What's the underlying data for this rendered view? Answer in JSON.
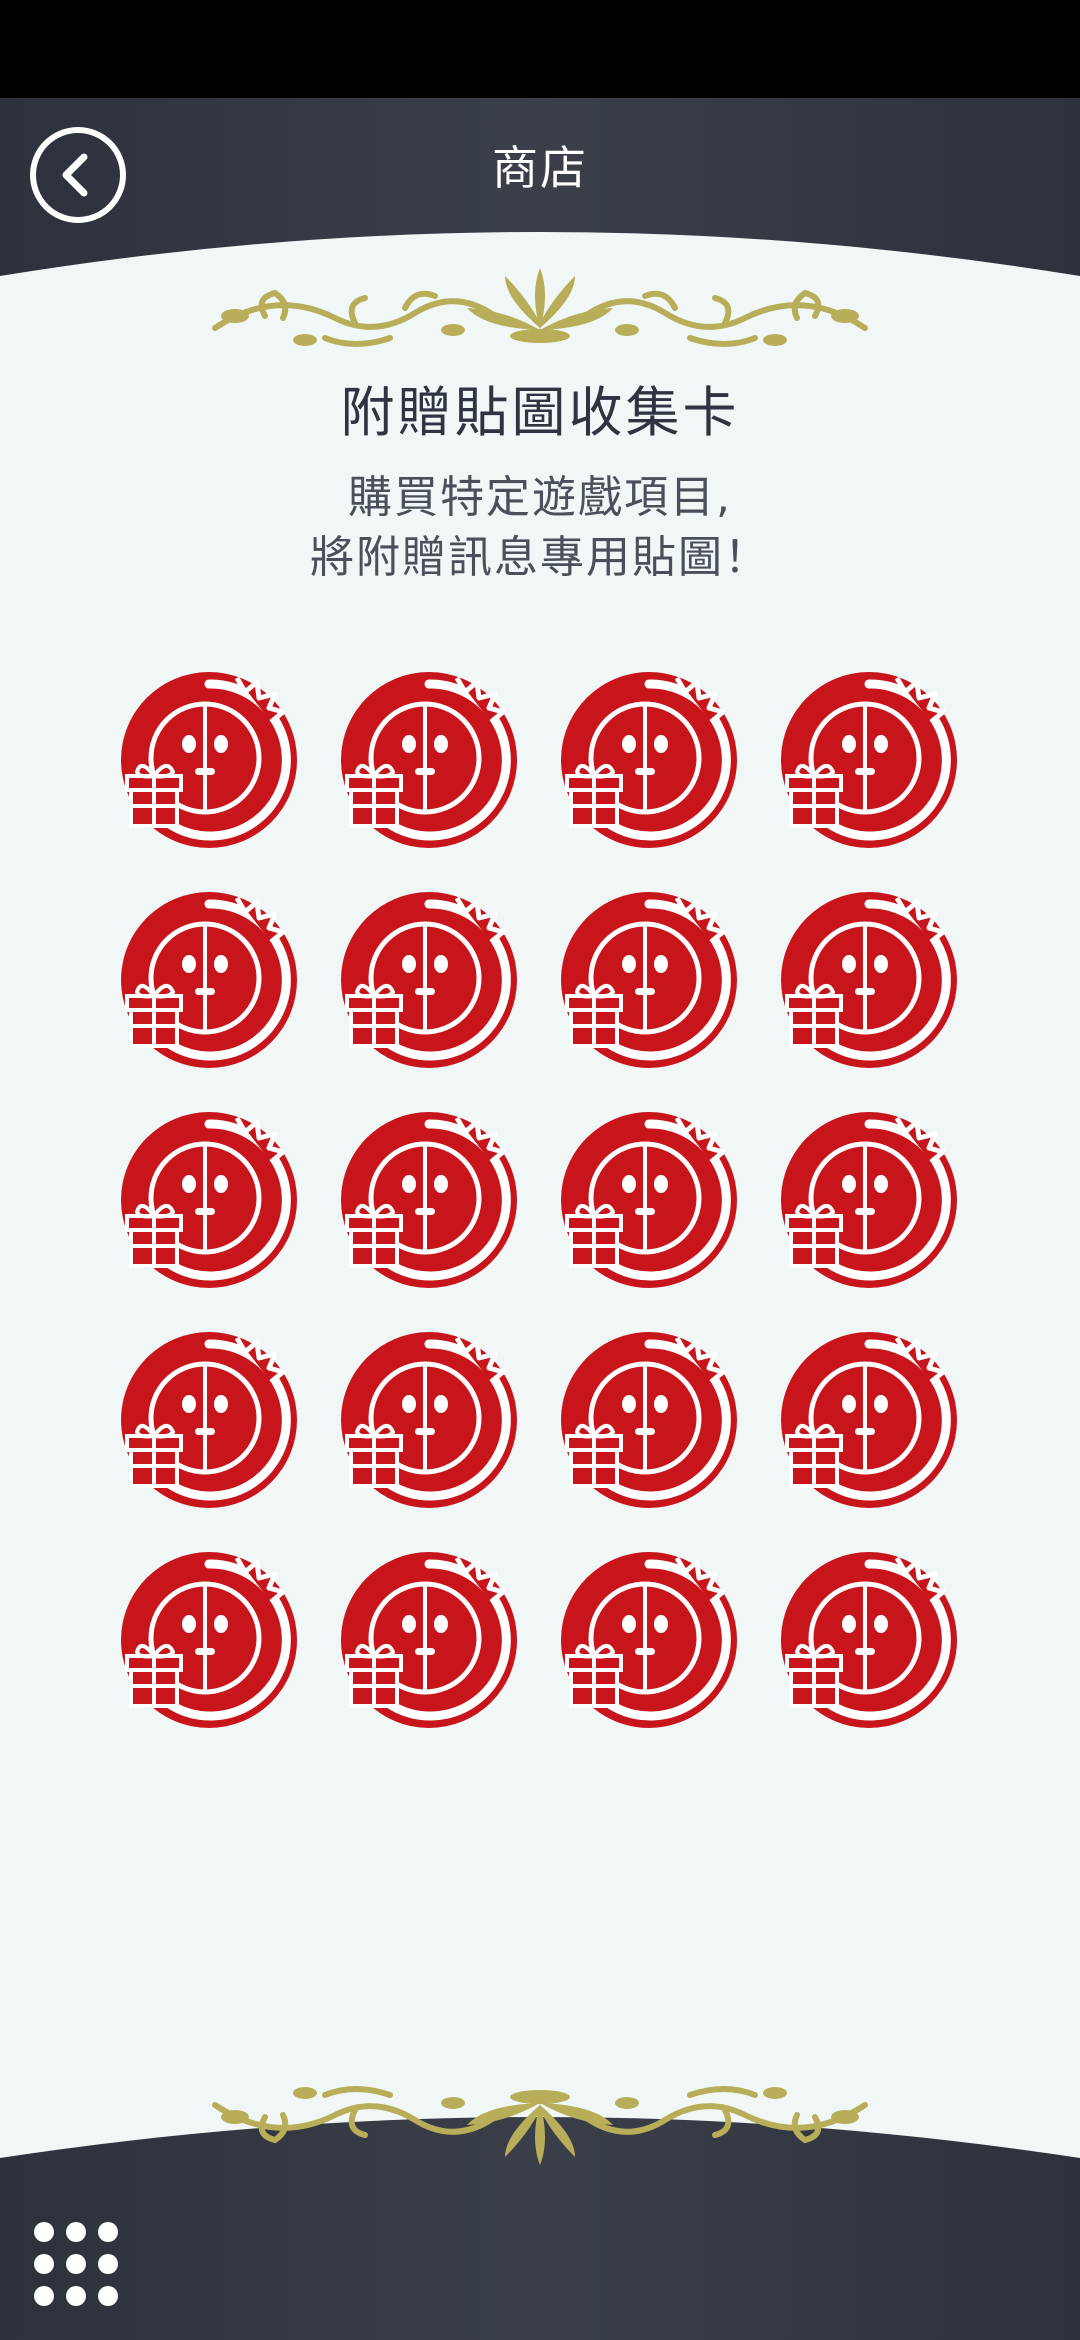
{
  "header": {
    "title": "商店",
    "back_icon": "chevron-left-circle-icon"
  },
  "card": {
    "title": "附贈貼圖收集卡",
    "subtitle_line1": "購買特定遊戲項目,",
    "subtitle_line2": "將附贈訊息專用貼圖！",
    "ornament_icon": "gold-floral-ornament"
  },
  "stickers": {
    "count": 20,
    "icon": "gift-stamp-sticker-icon",
    "color": "#c8151b"
  },
  "footer": {
    "menu_icon": "grid-menu-icon"
  },
  "colors": {
    "frame": "#343843",
    "card": "#f1f7f6",
    "gold": "#b8ae5a",
    "stamp_red": "#c8151b"
  }
}
